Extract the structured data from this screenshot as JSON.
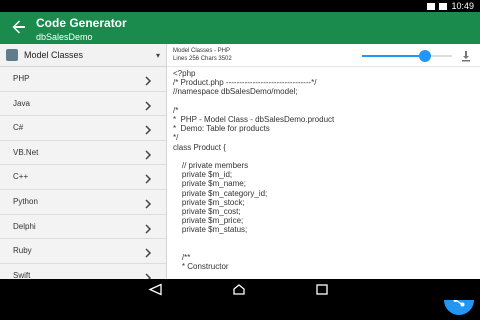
{
  "status": {
    "time": "10:49"
  },
  "app": {
    "title": "Code Generator",
    "subtitle": "dbSalesDemo"
  },
  "left": {
    "selector_label": "Model Classes",
    "items": [
      {
        "label": "PHP"
      },
      {
        "label": "Java"
      },
      {
        "label": "C#"
      },
      {
        "label": "VB.Net"
      },
      {
        "label": "C++"
      },
      {
        "label": "Python"
      },
      {
        "label": "Delphi"
      },
      {
        "label": "Ruby"
      },
      {
        "label": "Swift"
      }
    ]
  },
  "toolbar": {
    "title": "Model Classes - PHP",
    "stats": "Lines 256 Chars 3502",
    "zoom_level": 0.7
  },
  "code": {
    "lines": [
      "<?php",
      "/* Product.php --------------------------------*/",
      "//namespace dbSalesDemo/model;",
      "",
      "/*",
      "*  PHP - Model Class - dbSalesDemo.product",
      "*  Demo: Table for products",
      "*/",
      "class Product {",
      "",
      "    // private members",
      "    private $m_id;",
      "    private $m_name;",
      "    private $m_category_id;",
      "    private $m_stock;",
      "    private $m_cost;",
      "    private $m_price;",
      "    private $m_status;",
      "",
      "",
      "    /**",
      "    * Constructor"
    ]
  },
  "icons": {
    "back": "arrow-left-icon",
    "download": "download-icon",
    "share": "share-icon",
    "selector": "model-icon",
    "nav_back": "nav-back-icon",
    "nav_home": "nav-home-icon",
    "nav_recents": "nav-recents-icon"
  },
  "colors": {
    "appbar": "#1b8a4d",
    "accent": "#2196f3"
  }
}
